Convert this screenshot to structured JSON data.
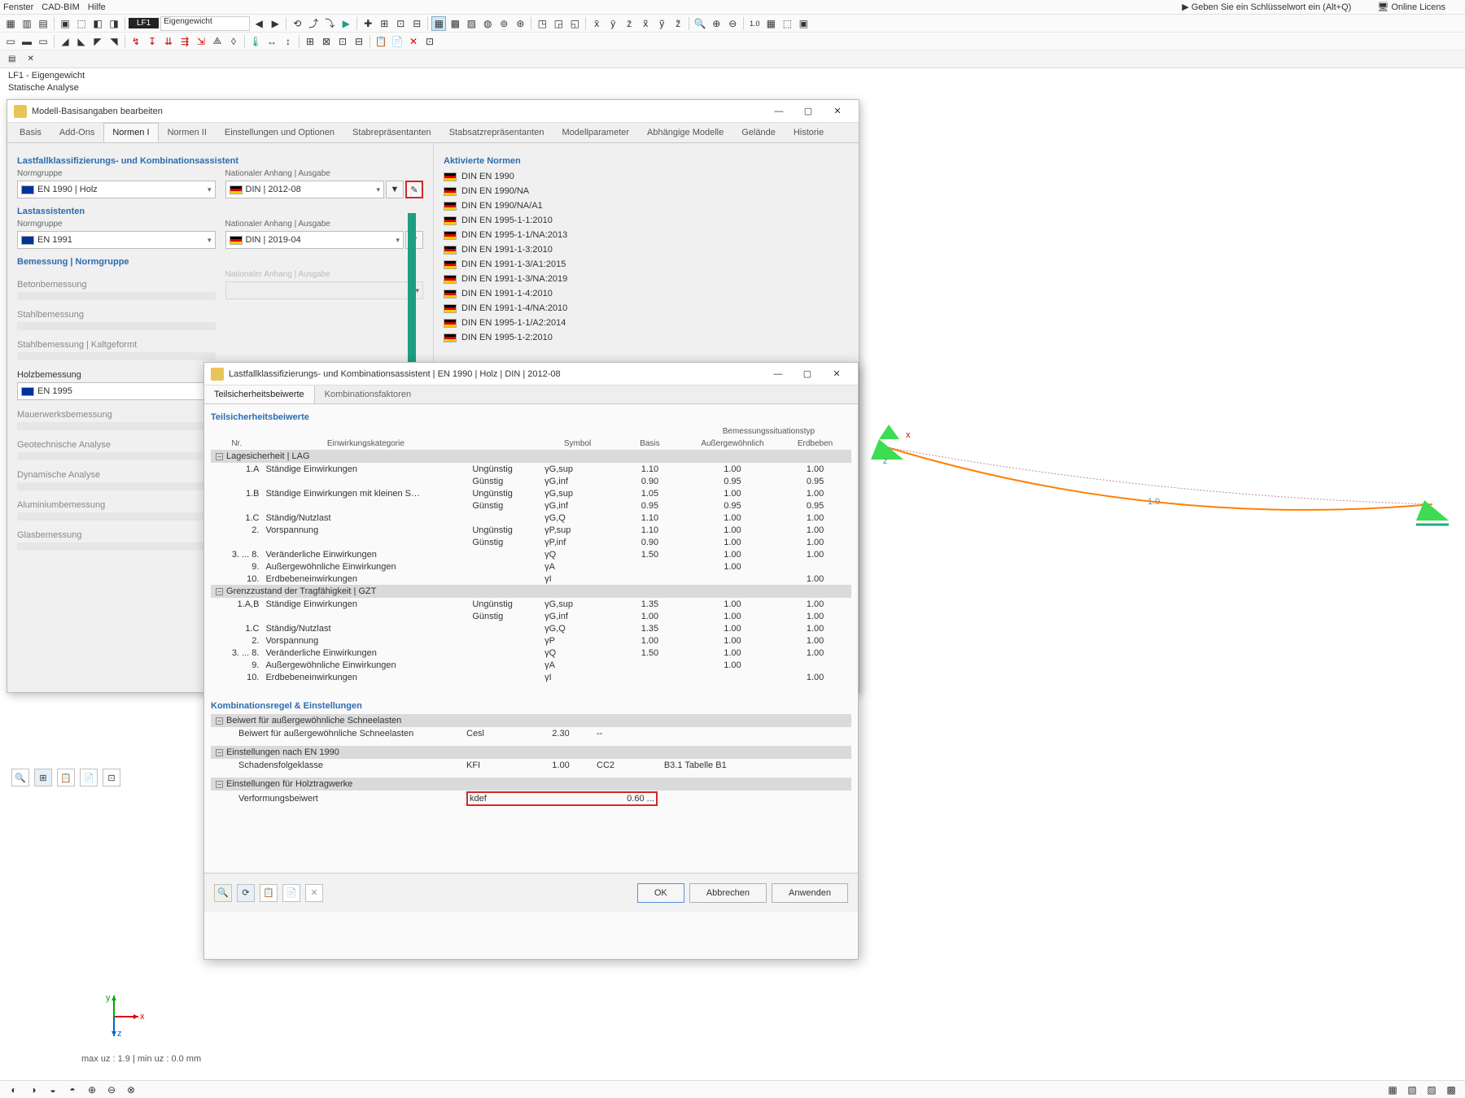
{
  "menu": {
    "fenster": "Fenster",
    "cad": "CAD-BIM",
    "hilfe": "Hilfe",
    "keyword": "Geben Sie ein Schlüsselwort ein (Alt+Q)",
    "license": "Online Licens"
  },
  "lf": {
    "tag": "LF1",
    "sel": "Eigengewicht",
    "tab": "LF1 - Eigengewicht",
    "ana": "Statische Analyse"
  },
  "dlg1": {
    "title": "Modell-Basisangaben bearbeiten",
    "tabs": [
      "Basis",
      "Add-Ons",
      "Normen I",
      "Normen II",
      "Einstellungen und Optionen",
      "Stabrepräsentanten",
      "Stabsatzrepräsentanten",
      "Modellparameter",
      "Abhängige Modelle",
      "Gelände",
      "Historie"
    ],
    "sec1": "Lastfallklassifizierungs- und Kombinationsassistent",
    "lbl_ng": "Normgruppe",
    "lbl_na": "Nationaler Anhang | Ausgabe",
    "cmb1": "EN 1990 | Holz",
    "cmb1b": "DIN | 2012-08",
    "sec2": "Lastassistenten",
    "cmb2": "EN 1991",
    "cmb2b": "DIN | 2019-04",
    "sec3": "Bemessung | Normgruppe",
    "bems": [
      "Betonbemessung",
      "Stahlbemessung",
      "Stahlbemessung | Kaltgeformt",
      "Holzbemessung",
      "Mauerwerksbemessung",
      "Geotechnische Analyse",
      "Dynamische Analyse",
      "Aluminiumbemessung",
      "Glasbemessung"
    ],
    "holz_norm": "EN 1995",
    "akt": "Aktivierte Normen",
    "norms": [
      "DIN EN 1990",
      "DIN EN 1990/NA",
      "DIN EN 1990/NA/A1",
      "DIN EN 1995-1-1:2010",
      "DIN EN 1995-1-1/NA:2013",
      "DIN EN 1991-1-3:2010",
      "DIN EN 1991-1-3/A1:2015",
      "DIN EN 1991-1-3/NA:2019",
      "DIN EN 1991-1-4:2010",
      "DIN EN 1991-1-4/NA:2010",
      "DIN EN 1995-1-1/A2:2014",
      "DIN EN 1995-1-2:2010"
    ]
  },
  "dlg2": {
    "title": "Lastfallklassifizierungs- und Kombinationsassistent | EN 1990 | Holz | DIN | 2012-08",
    "tab1": "Teilsicherheitsbeiwerte",
    "tab2": "Kombinationsfaktoren",
    "h1": "Teilsicherheitsbeiwerte",
    "col_nr": "Nr.",
    "col_kat": "Einwirkungskategorie",
    "col_sym": "Symbol",
    "col_bas": "Basis",
    "col_bst": "Bemessungssituationstyp",
    "col_aus": "Außergewöhnlich",
    "col_erd": "Erdbeben",
    "h_lag": "Lagesicherheit | LAG",
    "h_gzt": "Grenzzustand der Tragfähigkeit | GZT",
    "r": {
      "r1a": "1.A",
      "r1a_k": "Ständige Einwirkungen",
      "ung": "Ungünstig",
      "gun": "Günstig",
      "r1b": "1.B",
      "r1b_k": "Ständige Einwirkungen mit kleinen S…",
      "r1c": "1.C",
      "r1c_k": "Ständig/Nutzlast",
      "r2": "2.",
      "r2_k": "Vorspannung",
      "r38": "3. ... 8.",
      "r38_k": "Veränderliche Einwirkungen",
      "r9": "9.",
      "r9_k": "Außergewöhnliche Einwirkungen",
      "r10": "10.",
      "r10_k": "Erdbebeneinwirkungen",
      "g1ab": "1.A,B",
      "g1ab_k": "Ständige Einwirkungen"
    },
    "sym": {
      "gsup": "γG,sup",
      "ginf": "γG,inf",
      "gq": "γG,Q",
      "psup": "γP,sup",
      "pinf": "γP,inf",
      "q": "γQ",
      "a": "γA",
      "i": "γI",
      "p": "γP"
    },
    "h2": "Kombinationsregel & Einstellungen",
    "sn1": "Beiwert für außergewöhnliche Schneelasten",
    "sn1r": "Beiwert für außergewöhnliche Schneelasten",
    "sn1s": "Cesl",
    "sn1v": "2.30",
    "sn1d": "--",
    "sn2": "Einstellungen nach EN 1990",
    "sn2r": "Schadensfolgeklasse",
    "sn2s": "KFI",
    "sn2v": "1.00",
    "sn2c": "CC2",
    "sn2ref": "B3.1 Tabelle B1",
    "sn3": "Einstellungen für Holztragwerke",
    "sn3r": "Verformungsbeiwert",
    "sn3s": "kdef",
    "sn3v": "0.60",
    "sn3d": "...",
    "ok": "OK",
    "cancel": "Abbrechen",
    "apply": "Anwenden"
  },
  "beam_lbl": "1.9",
  "status": "max uz : 1.9 | min uz : 0.0 mm"
}
